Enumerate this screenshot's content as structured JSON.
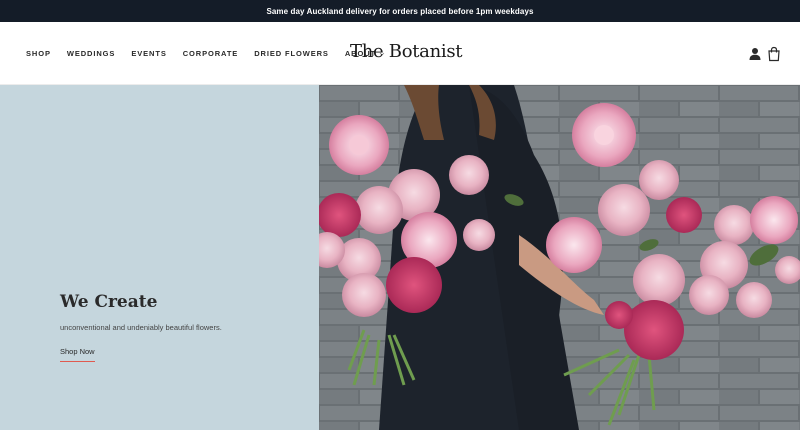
{
  "announcement": "Same day Auckland delivery for orders placed before 1pm weekdays",
  "nav": {
    "items": [
      "SHOP",
      "WEDDINGS",
      "EVENTS",
      "CORPORATE",
      "DRIED FLOWERS",
      "ABOUT"
    ]
  },
  "brand": {
    "logo": "The Botanist"
  },
  "header_icons": [
    "account-icon",
    "cart-icon"
  ],
  "hero": {
    "title": "We Create",
    "subtitle": "unconventional and undeniably beautiful flowers.",
    "cta": "Shop Now",
    "panel_color": "#c5d6dd",
    "cta_underline_color": "#e05a4f"
  }
}
